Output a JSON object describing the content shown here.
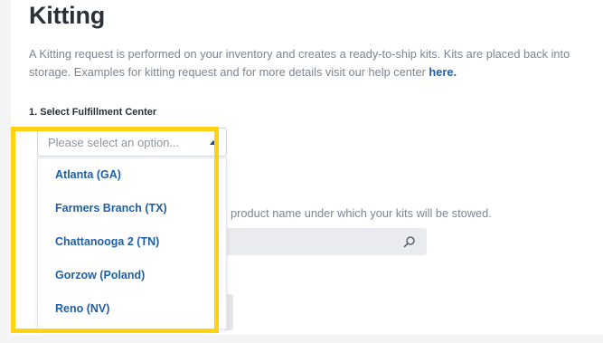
{
  "page": {
    "title": "Kitting",
    "description_line1": "A Kitting request is performed on your inventory and creates a ready-to-ship kits. Kits are placed back into",
    "description_line2_prefix": "storage. Examples for kitting request and for more details visit our help center ",
    "help_link": "here.",
    "helper_text": "product name under which your kits will be stowed."
  },
  "form": {
    "step1_label": "1. Select Fulfillment Center",
    "select": {
      "placeholder": "Please select an option...",
      "options": [
        "Atlanta (GA)",
        "Farmers Branch (TX)",
        "Chattanooga 2 (TN)",
        "Gorzow (Poland)",
        "Reno (NV)"
      ]
    }
  },
  "colors": {
    "highlight": "#ffd311",
    "link": "#1f5fa8",
    "title": "#2b3038",
    "muted_text": "#7d8594"
  },
  "icons": {
    "caret": "caret-up-icon",
    "search": "search-icon"
  }
}
